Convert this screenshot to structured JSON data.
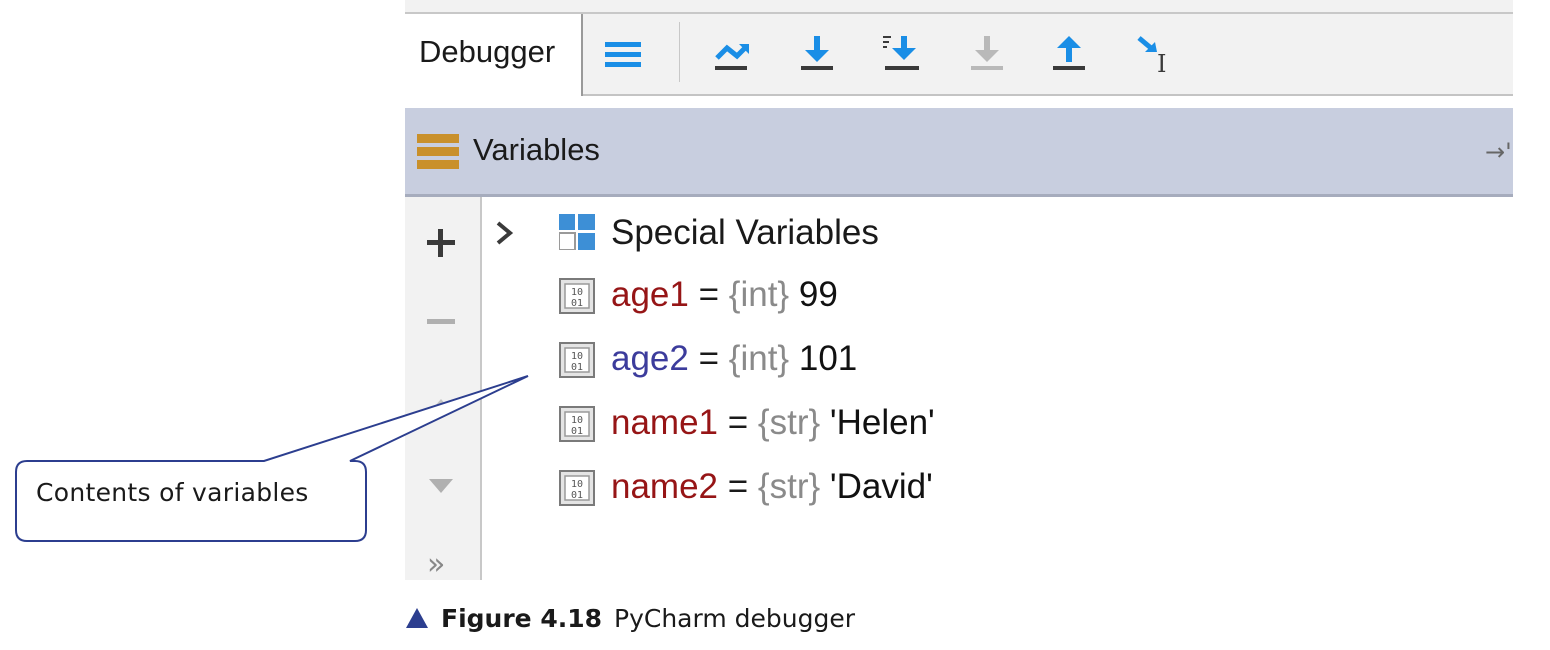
{
  "toolbar": {
    "tab_label": "Debugger",
    "icons": [
      "menu-icon",
      "show-execution-point-icon",
      "step-over-icon",
      "step-into-my-code-icon",
      "force-step-into-icon",
      "step-out-icon",
      "run-to-cursor-icon"
    ],
    "accent_color": "#1a8ee6"
  },
  "variables_panel": {
    "title": "Variables",
    "pin_glyph": "→'",
    "special_variables_label": "Special Variables",
    "rows": [
      {
        "name": "age1",
        "eq": " = ",
        "type": "{int}",
        "value": " 99",
        "name_color": "#961516"
      },
      {
        "name": "age2",
        "eq": " = ",
        "type": "{int}",
        "value": " 101",
        "name_color": "#3c3c9c"
      },
      {
        "name": "name1",
        "eq": " = ",
        "type": "{str}",
        "value": " 'Helen'",
        "name_color": "#961516"
      },
      {
        "name": "name2",
        "eq": " = ",
        "type": "{str}",
        "value": " 'David'",
        "name_color": "#961516"
      }
    ]
  },
  "gutter": {
    "buttons": [
      "add-icon",
      "remove-icon",
      "move-up-icon",
      "move-down-icon",
      "more-icon"
    ],
    "more_glyph": "»"
  },
  "callout": {
    "text": "Contents of variables",
    "stroke_color": "#2c3e8f"
  },
  "caption": {
    "label": "Figure 4.18",
    "text": "PyCharm debugger",
    "triangle_color": "#2c3e8f"
  }
}
